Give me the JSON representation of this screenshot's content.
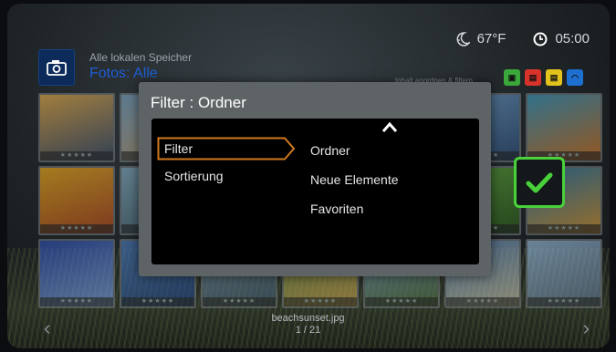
{
  "status": {
    "temperature": "67°F",
    "time": "05:00",
    "weather_icon": "moon-weather-icon",
    "clock_icon": "clock-icon"
  },
  "header": {
    "source": "Alle lokalen Speicher",
    "section": "Fotos: Alle",
    "camera_icon": "camera-icon"
  },
  "toolbar": {
    "sort_hint": "Inhalt anordnen & filtern",
    "keys": [
      {
        "name": "green",
        "color": "#3aa83a"
      },
      {
        "name": "red",
        "color": "#d8332b"
      },
      {
        "name": "yellow",
        "color": "#e2c21c"
      },
      {
        "name": "blue",
        "color": "#1d6fd0"
      }
    ]
  },
  "dialog": {
    "title": "Filter : Ordner",
    "left_items": [
      {
        "label": "Filter",
        "active": true
      },
      {
        "label": "Sortierung",
        "active": false
      }
    ],
    "right_options": [
      "Ordner",
      "Neue Elemente",
      "Favoriten"
    ],
    "accent": "#d07a1e"
  },
  "confirm": {
    "icon": "checkmark-icon",
    "accent": "#49d13a"
  },
  "footer": {
    "file_name": "beachsunset.jpg",
    "page": "1 / 21"
  },
  "thumbnails": [
    {
      "name": "sunset-sea",
      "colors": [
        "#f0b44a",
        "#3b4c6b"
      ]
    },
    {
      "name": "beach",
      "colors": [
        "#7aa7c8",
        "#c9a372"
      ]
    },
    {
      "name": "coast",
      "colors": [
        "#6a93b8",
        "#2e4a6a"
      ]
    },
    {
      "name": "mountain",
      "colors": [
        "#8fb4d6",
        "#4a6d35"
      ]
    },
    {
      "name": "waterfall",
      "colors": [
        "#5d7f66",
        "#2a3a2a"
      ]
    },
    {
      "name": "lake",
      "colors": [
        "#6ea2cf",
        "#2c4e7a"
      ]
    },
    {
      "name": "clownfish",
      "colors": [
        "#3fa0c7",
        "#e07a20"
      ]
    },
    {
      "name": "fireworks",
      "colors": [
        "#f6b21b",
        "#b6461a"
      ]
    },
    {
      "name": "bird",
      "colors": [
        "#86b0c8",
        "#4a6a72"
      ]
    },
    {
      "name": "city",
      "colors": [
        "#4f6f8f",
        "#2a3a4a"
      ]
    },
    {
      "name": "field",
      "colors": [
        "#b9c96a",
        "#5f7a2a"
      ]
    },
    {
      "name": "reef",
      "colors": [
        "#3b8fb3",
        "#c76b2b"
      ]
    },
    {
      "name": "green-leaf",
      "colors": [
        "#5fae3a",
        "#2d5d1a"
      ]
    },
    {
      "name": "fish",
      "colors": [
        "#2e7fb0",
        "#e5a134"
      ]
    },
    {
      "name": "flowers",
      "colors": [
        "#2c4fb0",
        "#7aa0e0"
      ]
    },
    {
      "name": "blue-sea",
      "colors": [
        "#4d7fbf",
        "#1d3e7a"
      ]
    },
    {
      "name": "harbor",
      "colors": [
        "#7a94a8",
        "#3d5668"
      ]
    },
    {
      "name": "sunset-field",
      "colors": [
        "#6f8f4a",
        "#c9a04a"
      ]
    },
    {
      "name": "hills",
      "colors": [
        "#7aa5c9",
        "#4c6a3a"
      ]
    },
    {
      "name": "coast-town",
      "colors": [
        "#5a86b8",
        "#c7c0a6"
      ]
    },
    {
      "name": "venice",
      "colors": [
        "#9cc1e0",
        "#5b6f86"
      ]
    }
  ]
}
